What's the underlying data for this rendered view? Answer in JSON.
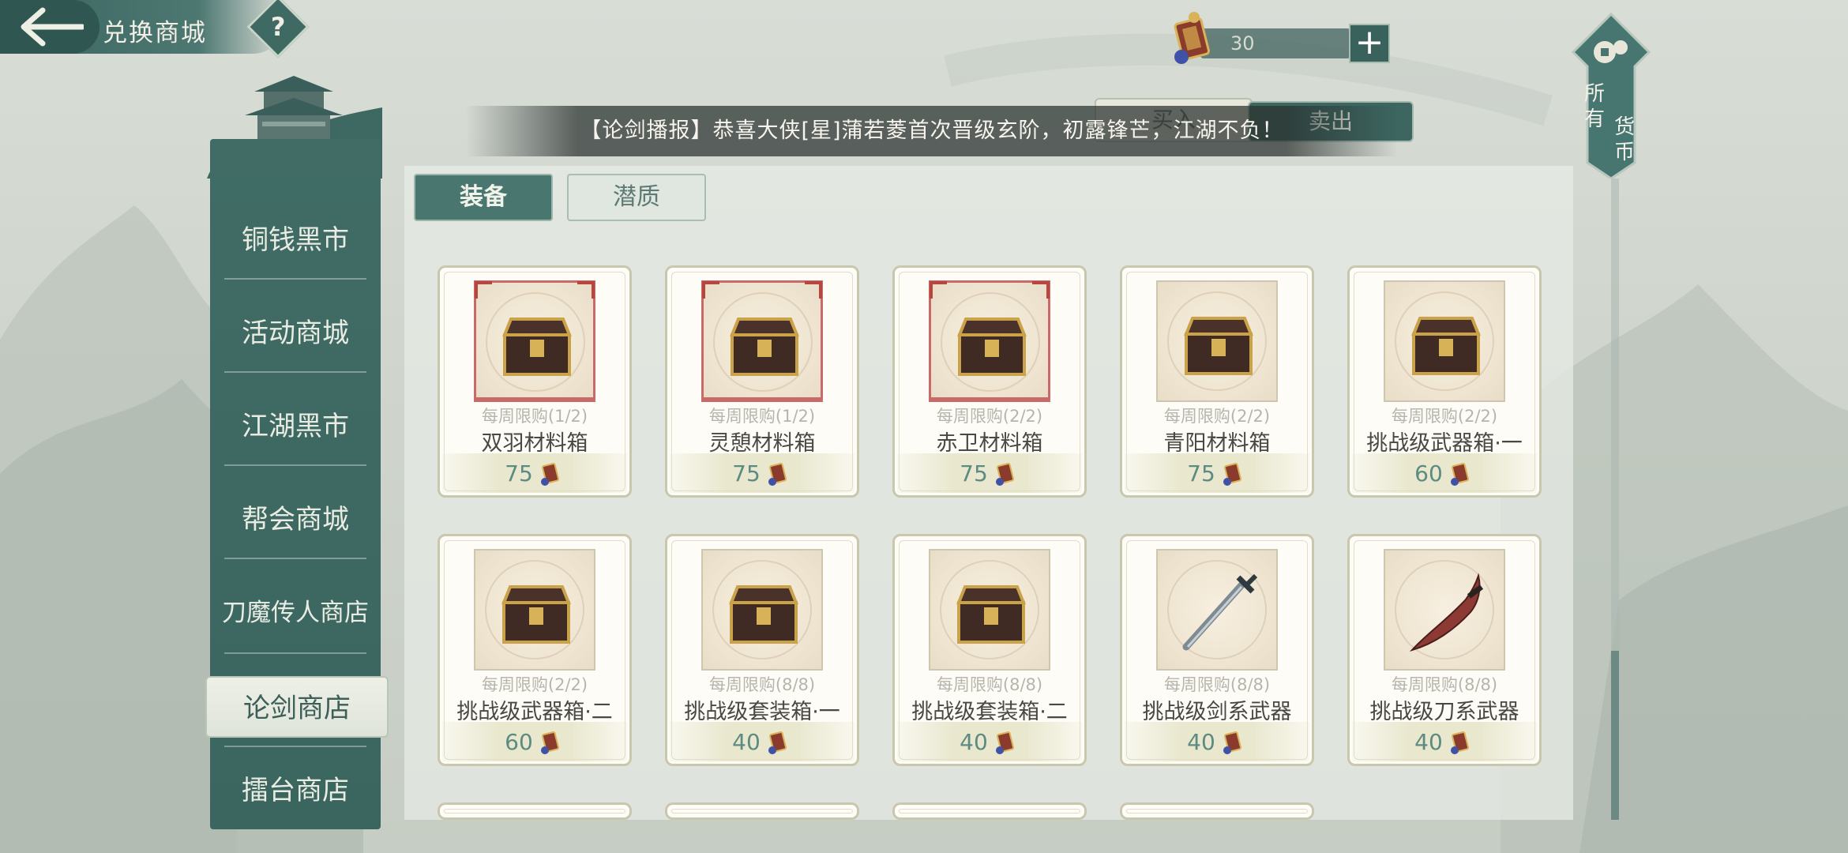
{
  "header": {
    "title": "兑换商城",
    "help_label": "?"
  },
  "currency": {
    "amount": "30",
    "add_label": "+"
  },
  "trade_tabs": {
    "buy": "买入",
    "sell": "卖出"
  },
  "broadcast": "【论剑播报】恭喜大侠[星]蒲若菱首次晋级玄阶，初露锋芒，江湖不负！",
  "all_currency": {
    "label": "所有货币",
    "chars": [
      "所",
      "有",
      "货",
      "币"
    ]
  },
  "sidebar": {
    "items": [
      {
        "label": "铜钱黑市",
        "active": false
      },
      {
        "label": "活动商城",
        "active": false
      },
      {
        "label": "江湖黑市",
        "active": false
      },
      {
        "label": "帮会商城",
        "active": false
      },
      {
        "label": "刀魔传人商店",
        "active": false
      },
      {
        "label": "论剑商店",
        "active": true
      },
      {
        "label": "擂台商店",
        "active": false
      }
    ]
  },
  "category_tabs": [
    {
      "label": "装备",
      "active": true
    },
    {
      "label": "潜质",
      "active": false
    }
  ],
  "items": [
    {
      "limit": "每周限购(1/2)",
      "name": "双羽材料箱",
      "price": "75",
      "icon": "chest-icon",
      "red_frame": true
    },
    {
      "limit": "每周限购(1/2)",
      "name": "灵憩材料箱",
      "price": "75",
      "icon": "chest-icon",
      "red_frame": true
    },
    {
      "limit": "每周限购(2/2)",
      "name": "赤卫材料箱",
      "price": "75",
      "icon": "chest-icon",
      "red_frame": true
    },
    {
      "limit": "每周限购(2/2)",
      "name": "青阳材料箱",
      "price": "75",
      "icon": "chest-icon",
      "red_frame": false
    },
    {
      "limit": "每周限购(2/2)",
      "name": "挑战级武器箱·一",
      "price": "60",
      "icon": "chest-icon",
      "red_frame": false
    },
    {
      "limit": "每周限购(2/2)",
      "name": "挑战级武器箱·二",
      "price": "60",
      "icon": "chest-icon",
      "red_frame": false
    },
    {
      "limit": "每周限购(8/8)",
      "name": "挑战级套装箱·一",
      "price": "40",
      "icon": "chest-icon",
      "red_frame": false
    },
    {
      "limit": "每周限购(8/8)",
      "name": "挑战级套装箱·二",
      "price": "40",
      "icon": "chest-icon",
      "red_frame": false
    },
    {
      "limit": "每周限购(8/8)",
      "name": "挑战级剑系武器",
      "price": "40",
      "icon": "sword-icon",
      "red_frame": false
    },
    {
      "limit": "每周限购(8/8)",
      "name": "挑战级刀系武器",
      "price": "40",
      "icon": "blade-icon",
      "red_frame": false
    }
  ],
  "colors": {
    "jade": "#416c66",
    "price": "#5c8b82",
    "limit": "#b7b5ab",
    "red_frame": "#c96a6a"
  }
}
